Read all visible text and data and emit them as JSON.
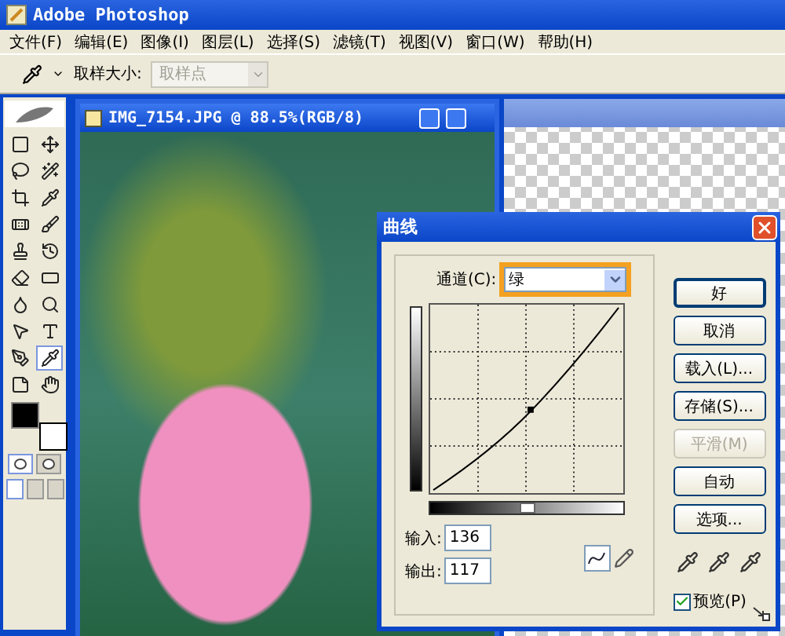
{
  "app": {
    "title": "Adobe Photoshop"
  },
  "menu": [
    "文件(F)",
    "编辑(E)",
    "图像(I)",
    "图层(L)",
    "选择(S)",
    "滤镜(T)",
    "视图(V)",
    "窗口(W)",
    "帮助(H)"
  ],
  "options_bar": {
    "sample_label": "取样大小:",
    "sample_value": "取样点"
  },
  "toolbox": {
    "tools": [
      {
        "selected": false
      },
      {
        "selected": false
      },
      {
        "selected": false
      },
      {
        "selected": false
      },
      {
        "selected": false
      },
      {
        "selected": false
      },
      {
        "selected": false
      },
      {
        "selected": false
      },
      {
        "selected": false
      },
      {
        "selected": false
      },
      {
        "selected": false
      },
      {
        "selected": false
      },
      {
        "selected": false
      },
      {
        "selected": false
      },
      {
        "selected": false
      },
      {
        "selected": false
      },
      {
        "selected": false
      },
      {
        "selected": true
      },
      {
        "selected": false
      },
      {
        "selected": false
      }
    ],
    "quick_mask": [
      {
        "selected": true
      },
      {
        "selected": false
      }
    ],
    "screen_modes": [
      {
        "selected": true
      },
      {
        "selected": false
      },
      {
        "selected": false
      }
    ]
  },
  "document": {
    "title": "IMG_7154.JPG @ 88.5%(RGB/8)"
  },
  "curves_dialog": {
    "title": "曲线",
    "channel_label": "通道(C):",
    "channel_value": "绿",
    "channel_highlighted": true,
    "input_label": "输入:",
    "input_value": "136",
    "output_label": "输出:",
    "output_value": "117",
    "buttons": [
      {
        "label": "好",
        "disabled": false,
        "default": true
      },
      {
        "label": "取消",
        "disabled": false,
        "default": false
      },
      {
        "label": "载入(L)...",
        "disabled": false,
        "default": false
      },
      {
        "label": "存储(S)...",
        "disabled": false,
        "default": false
      },
      {
        "label": "平滑(M)",
        "disabled": true,
        "default": false
      },
      {
        "label": "自动",
        "disabled": false,
        "default": false
      },
      {
        "label": "选项...",
        "disabled": false,
        "default": false
      }
    ],
    "preview": {
      "label": "预览(P)",
      "checked": true
    }
  }
}
